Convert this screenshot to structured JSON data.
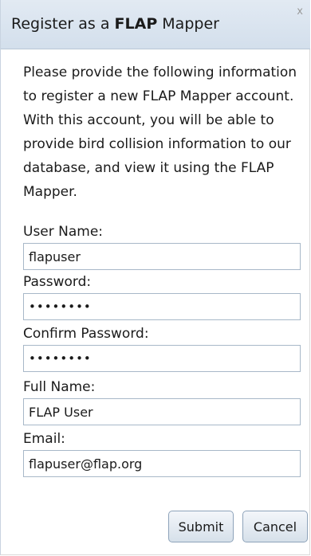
{
  "dialog": {
    "title_prefix": "Register as a ",
    "title_brand": "FLAP",
    "title_suffix": " Mapper",
    "close_label": "x",
    "intro_text": "Please provide the following information to register a new FLAP Mapper account. With this account, you will be able to provide bird collision information to our database, and view it using the FLAP Mapper."
  },
  "form": {
    "username_label": "User Name:",
    "username_value": "flapuser",
    "password_label": "Password:",
    "password_value": "••••••••",
    "confirm_label": "Confirm Password:",
    "confirm_value": "••••••••",
    "fullname_label": "Full Name:",
    "fullname_value": "FLAP User",
    "email_label": "Email:",
    "email_value": "flapuser@flap.org"
  },
  "buttons": {
    "submit_label": "Submit",
    "cancel_label": "Cancel"
  }
}
